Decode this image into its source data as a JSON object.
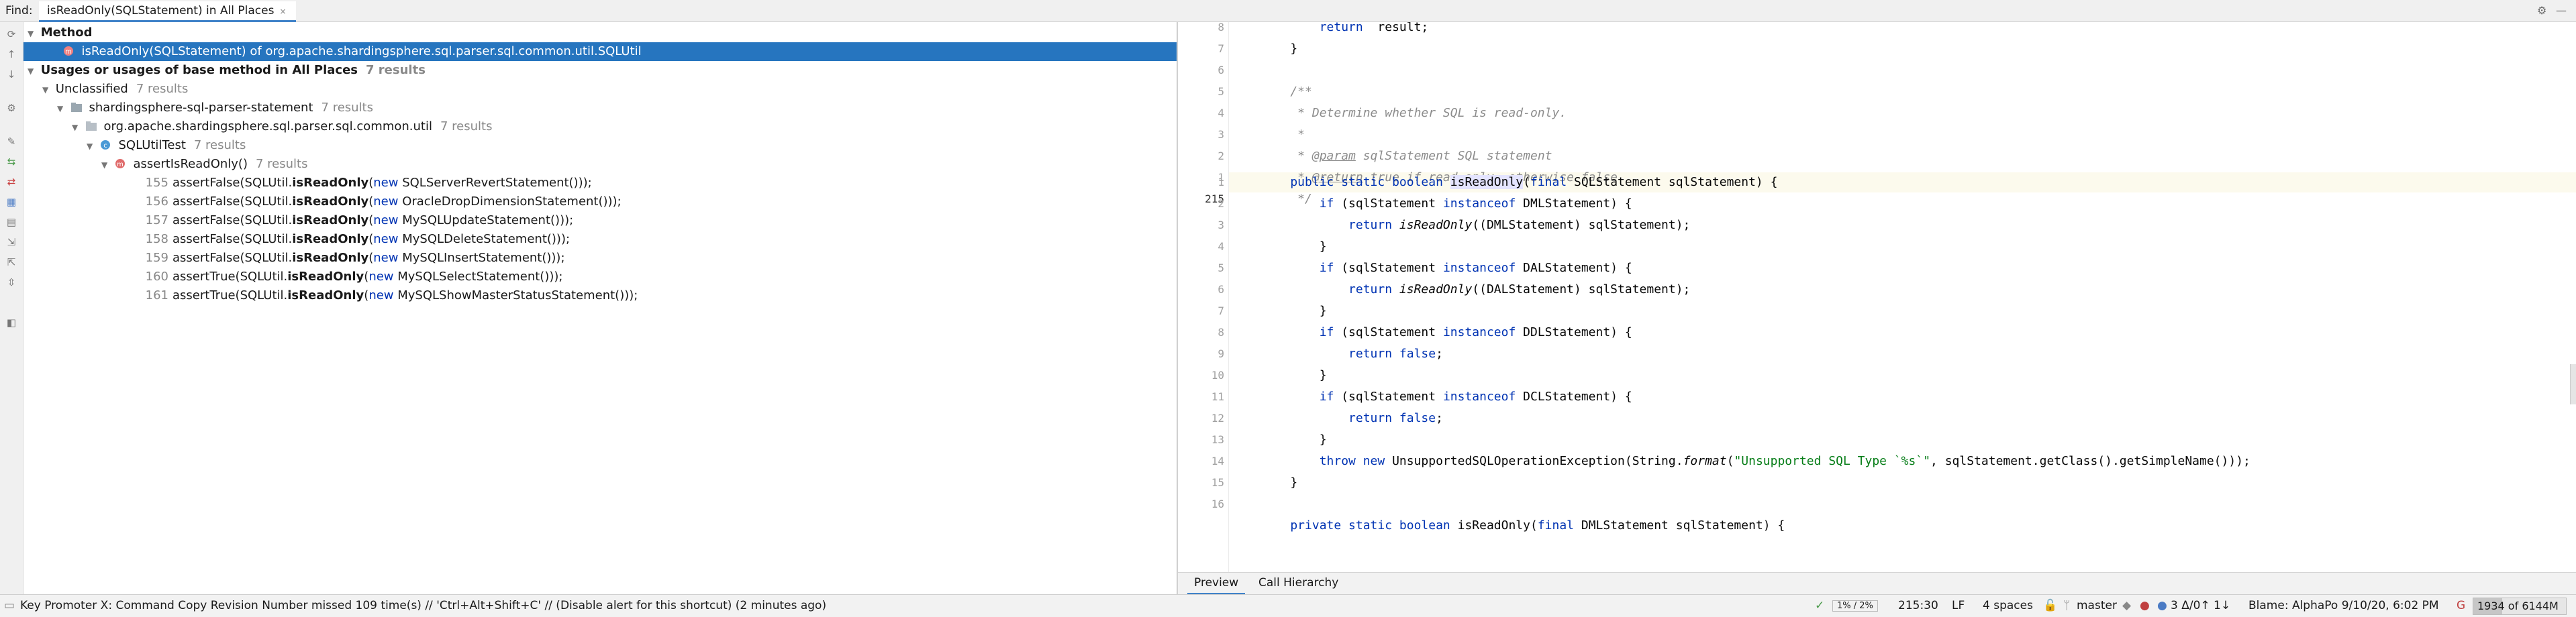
{
  "findbar": {
    "label": "Find:",
    "tab_title": "isReadOnly(SQLStatement) in All Places",
    "tab_close": "×",
    "settings_icon": "gear-icon",
    "minimize_icon": "minimize-icon"
  },
  "tree": {
    "method_header": "Method",
    "method_item": "isReadOnly(SQLStatement) of org.apache.shardingsphere.sql.parser.sql.common.util.SQLUtil",
    "usages_header": "Usages or usages of base method in All Places",
    "usages_count": "7 results",
    "unclassified": "Unclassified",
    "unclassified_count": "7 results",
    "module": "shardingsphere-sql-parser-statement",
    "module_count": "7 results",
    "package": "org.apache.shardingsphere.sql.parser.sql.common.util",
    "package_count": "7 results",
    "class": "SQLUtilTest",
    "class_count": "7 results",
    "method": "assertIsReadOnly()",
    "method_count": "7 results",
    "usages": [
      {
        "line": "155",
        "pre": "assertFalse(SQLUtil.",
        "call": "isReadOnly",
        "open": "(",
        "kw": "new",
        "post": " SQLServerRevertStatement()));"
      },
      {
        "line": "156",
        "pre": "assertFalse(SQLUtil.",
        "call": "isReadOnly",
        "open": "(",
        "kw": "new",
        "post": " OracleDropDimensionStatement()));"
      },
      {
        "line": "157",
        "pre": "assertFalse(SQLUtil.",
        "call": "isReadOnly",
        "open": "(",
        "kw": "new",
        "post": " MySQLUpdateStatement()));"
      },
      {
        "line": "158",
        "pre": "assertFalse(SQLUtil.",
        "call": "isReadOnly",
        "open": "(",
        "kw": "new",
        "post": " MySQLDeleteStatement()));"
      },
      {
        "line": "159",
        "pre": "assertFalse(SQLUtil.",
        "call": "isReadOnly",
        "open": "(",
        "kw": "new",
        "post": " MySQLInsertStatement()));"
      },
      {
        "line": "160",
        "pre": "assertTrue(SQLUtil.",
        "call": "isReadOnly",
        "open": "(",
        "kw": "new",
        "post": " MySQLSelectStatement()));"
      },
      {
        "line": "161",
        "pre": "assertTrue(SQLUtil.",
        "call": "isReadOnly",
        "open": "(",
        "kw": "new",
        "post": " MySQLShowMasterStatusStatement()));"
      }
    ]
  },
  "editor": {
    "gutter": [
      "8",
      "7",
      "6",
      "5",
      "4",
      "3",
      "2",
      "1",
      "215",
      "1",
      "2",
      "3",
      "4",
      "5",
      "6",
      "7",
      "8",
      "9",
      "10",
      "11",
      "12",
      "13",
      "14",
      "15",
      "16"
    ],
    "lines": [
      {
        "parts": [
          [
            "k",
            "        return"
          ],
          [
            "",
            "  result;"
          ]
        ]
      },
      {
        "parts": [
          [
            "",
            "    }"
          ]
        ]
      },
      {
        "parts": [
          [
            "",
            ""
          ]
        ]
      },
      {
        "parts": [
          [
            "cm",
            "    /**"
          ]
        ]
      },
      {
        "parts": [
          [
            "cm",
            "     * Determine whether SQL is read-only."
          ]
        ]
      },
      {
        "parts": [
          [
            "cm",
            "     *"
          ]
        ]
      },
      {
        "parts": [
          [
            "cm",
            "     * "
          ],
          [
            "tag",
            "@param"
          ],
          [
            "cm",
            " sqlStatement"
          ],
          [
            "cm",
            " SQL statement"
          ]
        ]
      },
      {
        "parts": [
          [
            "cm",
            "     * "
          ],
          [
            "tag",
            "@return"
          ],
          [
            "cm",
            " true if read-only, otherwise false"
          ]
        ]
      },
      {
        "parts": [
          [
            "cm",
            "     */"
          ]
        ]
      },
      {
        "parts": [
          [
            "k",
            "    public static boolean "
          ],
          [
            "hl",
            "isReadOnly"
          ],
          [
            "",
            "("
          ],
          [
            "k",
            "final"
          ],
          [
            "",
            " SQLStatement sqlStatement) {"
          ]
        ]
      },
      {
        "parts": [
          [
            "k",
            "        if"
          ],
          [
            "",
            " (sqlStatement "
          ],
          [
            "k",
            "instanceof"
          ],
          [
            "",
            " DMLStatement) {"
          ]
        ]
      },
      {
        "parts": [
          [
            "k",
            "            return "
          ],
          [
            "it",
            "isReadOnly"
          ],
          [
            "",
            "((DMLStatement) sqlStatement);"
          ]
        ]
      },
      {
        "parts": [
          [
            "",
            "        }"
          ]
        ]
      },
      {
        "parts": [
          [
            "k",
            "        if"
          ],
          [
            "",
            " (sqlStatement "
          ],
          [
            "k",
            "instanceof"
          ],
          [
            "",
            " DALStatement) {"
          ]
        ]
      },
      {
        "parts": [
          [
            "k",
            "            return "
          ],
          [
            "it",
            "isReadOnly"
          ],
          [
            "",
            "((DALStatement) sqlStatement);"
          ]
        ]
      },
      {
        "parts": [
          [
            "",
            "        }"
          ]
        ]
      },
      {
        "parts": [
          [
            "k",
            "        if"
          ],
          [
            "",
            " (sqlStatement "
          ],
          [
            "k",
            "instanceof"
          ],
          [
            "",
            " DDLStatement) {"
          ]
        ]
      },
      {
        "parts": [
          [
            "k",
            "            return false"
          ],
          [
            "",
            ";"
          ]
        ]
      },
      {
        "parts": [
          [
            "",
            "        }"
          ]
        ]
      },
      {
        "parts": [
          [
            "k",
            "        if"
          ],
          [
            "",
            " (sqlStatement "
          ],
          [
            "k",
            "instanceof"
          ],
          [
            "",
            " DCLStatement) {"
          ]
        ]
      },
      {
        "parts": [
          [
            "k",
            "            return false"
          ],
          [
            "",
            ";"
          ]
        ]
      },
      {
        "parts": [
          [
            "",
            "        }"
          ]
        ]
      },
      {
        "parts": [
          [
            "k",
            "        throw new"
          ],
          [
            "",
            " UnsupportedSQLOperationException(String."
          ],
          [
            "it",
            "format"
          ],
          [
            "",
            "("
          ],
          [
            "str",
            "\"Unsupported SQL Type `%s`\""
          ],
          [
            "",
            ", sqlStatement.getClass().getSimpleName()));"
          ]
        ]
      },
      {
        "parts": [
          [
            "",
            "    }"
          ]
        ]
      },
      {
        "parts": [
          [
            "",
            ""
          ]
        ]
      },
      {
        "parts": [
          [
            "k",
            "    private static boolean "
          ],
          [
            "",
            "isReadOnly("
          ],
          [
            "k",
            "final"
          ],
          [
            "",
            " DMLStatement sqlStatement) {"
          ]
        ]
      }
    ]
  },
  "editor_tabs": [
    "Preview",
    "Call Hierarchy"
  ],
  "status": {
    "message": "Key Promoter X: Command Copy Revision Number missed 109 time(s) // 'Ctrl+Alt+Shift+C' // (Disable alert for this shortcut) (2 minutes ago)",
    "percent": "1% / 2%",
    "position": "215:30",
    "line_sep": "LF",
    "indent": "4 spaces",
    "branch": "master",
    "vcs_changes": "3 Δ/0↑ 1↓",
    "blame": "Blame: AlphaPo 9/10/20, 6:02 PM",
    "memory": "1934 of 6144M",
    "memory_fraction": 0.31
  }
}
